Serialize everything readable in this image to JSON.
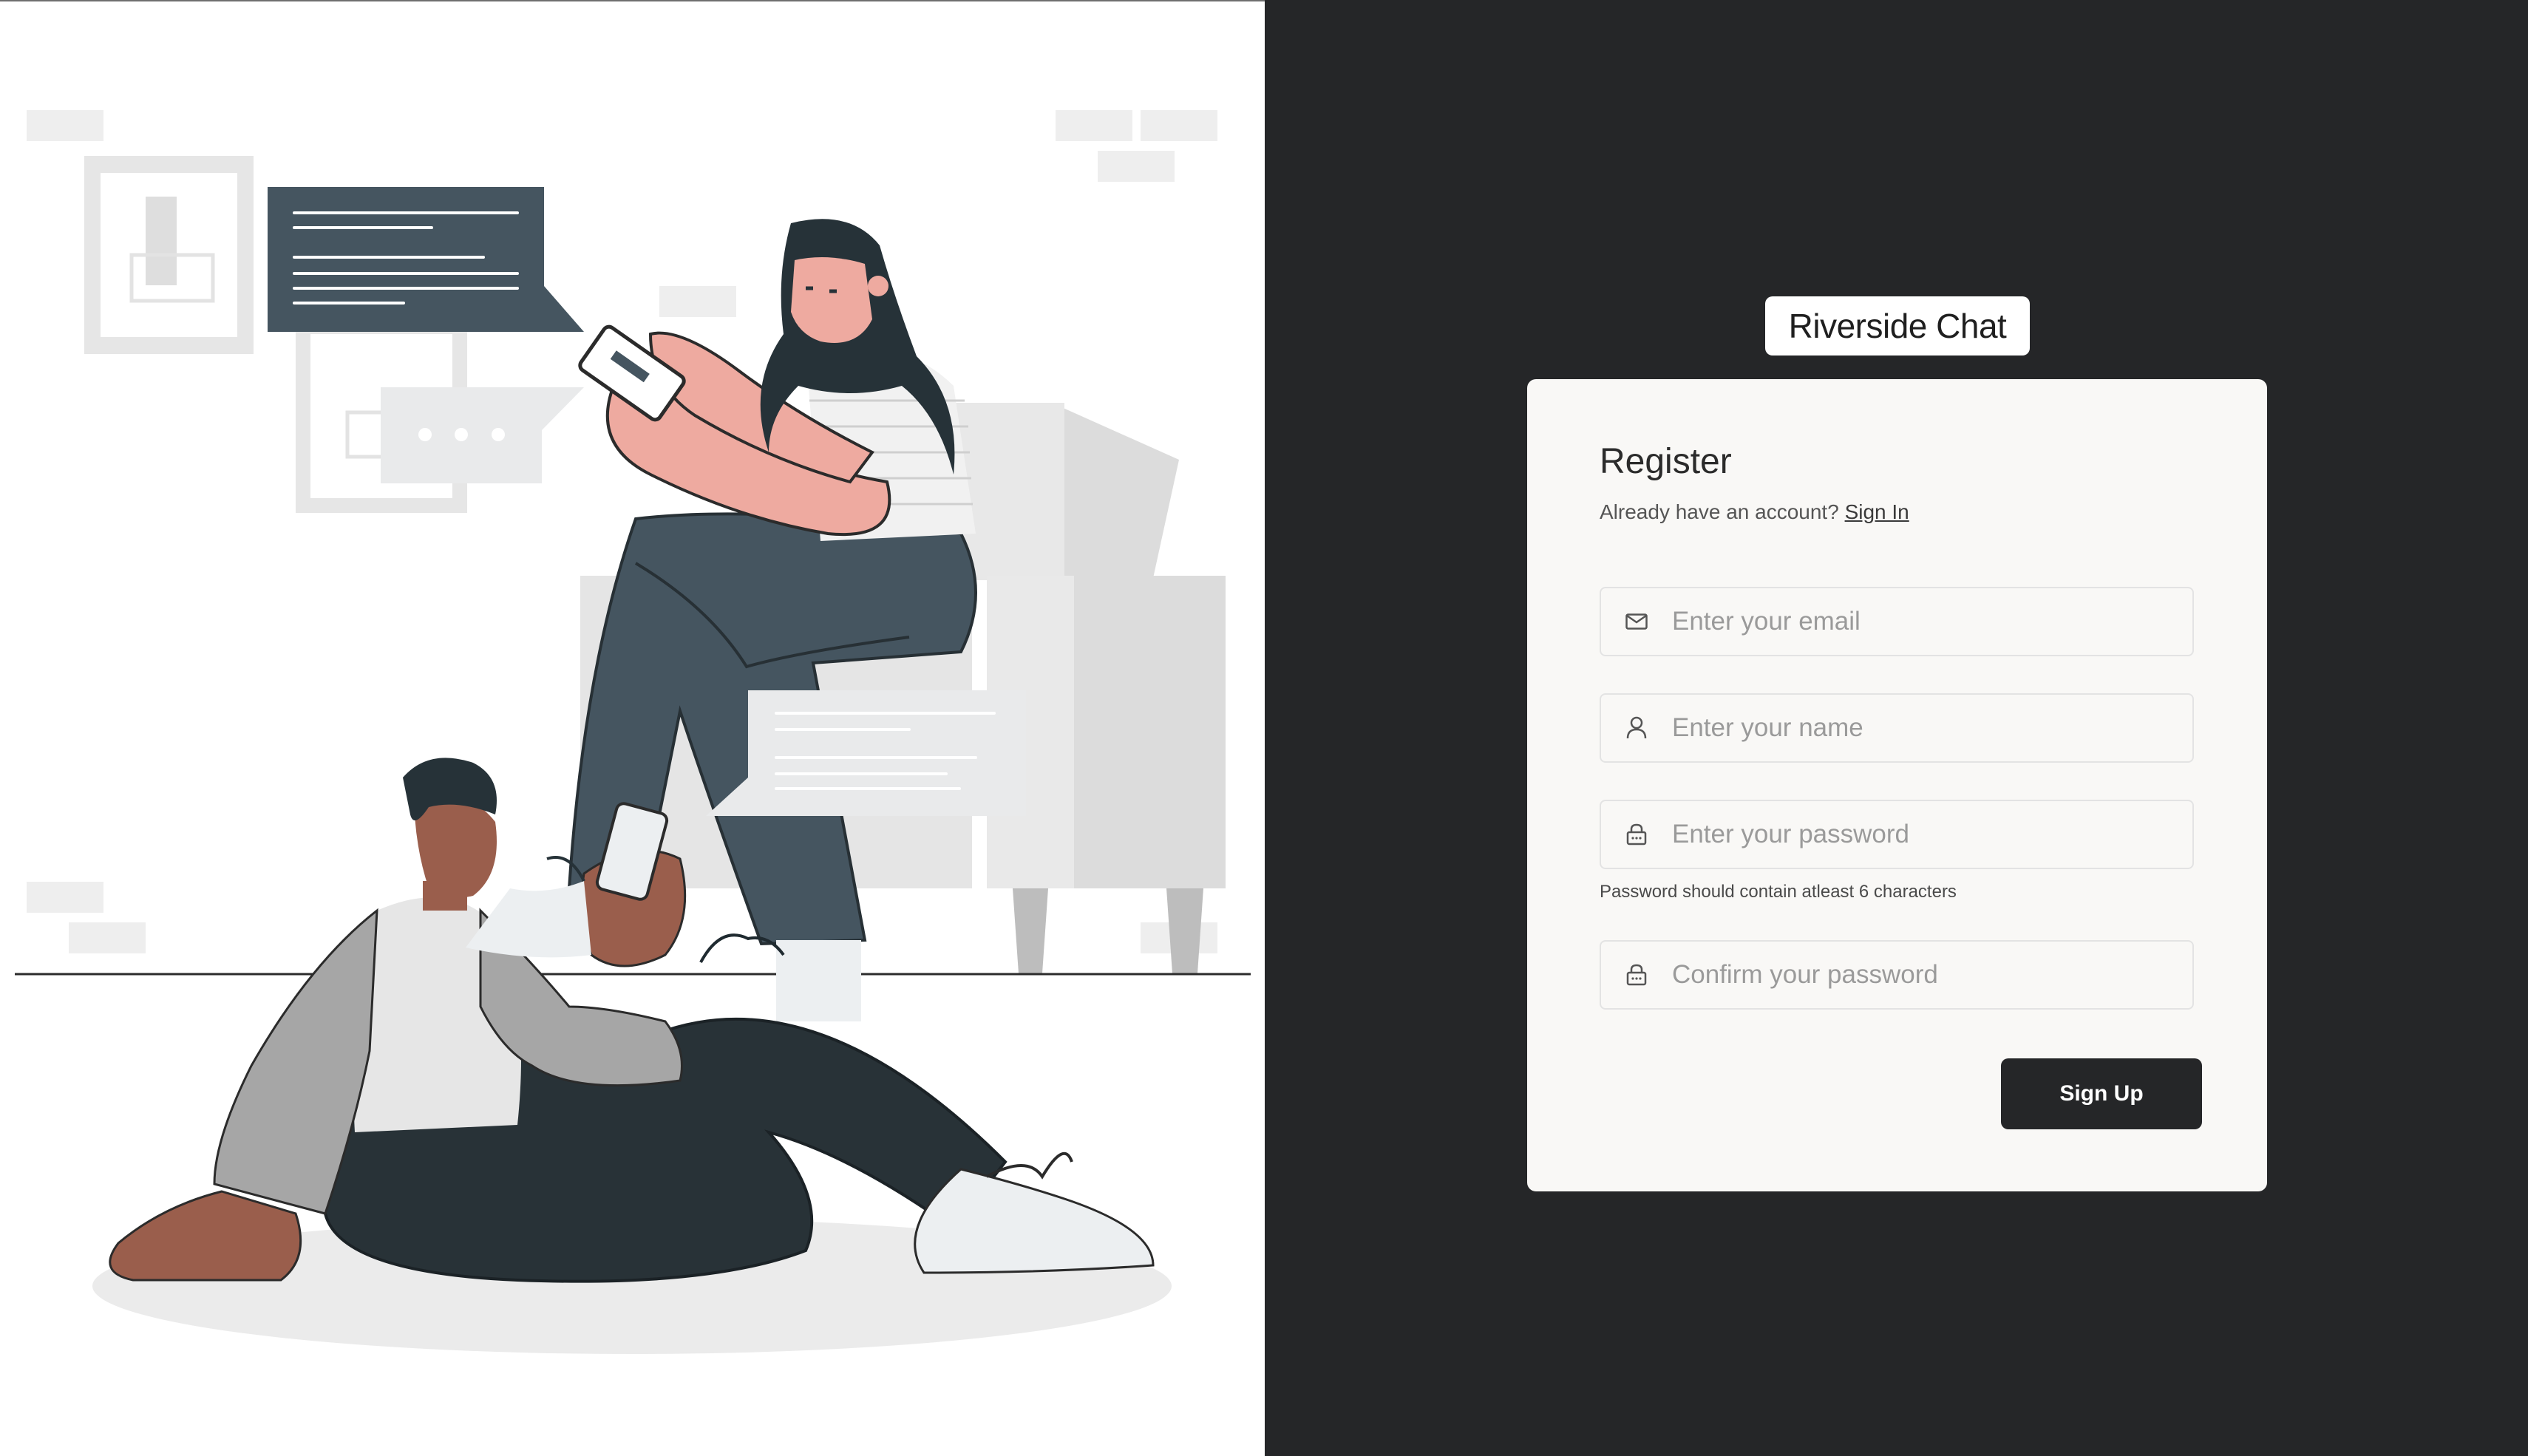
{
  "brand": {
    "title": "Riverside Chat"
  },
  "register": {
    "heading": "Register",
    "subtitle_prefix": "Already have an account?",
    "signin_link": "Sign In"
  },
  "fields": {
    "email": {
      "placeholder": "Enter your email",
      "value": "",
      "icon": "mail-icon"
    },
    "name": {
      "placeholder": "Enter your name",
      "value": "",
      "icon": "user-icon"
    },
    "password": {
      "placeholder": "Enter your password",
      "value": "",
      "icon": "lock-icon"
    },
    "password_hint": "Password should contain atleast 6 characters",
    "confirm": {
      "placeholder": "Confirm your password",
      "value": "",
      "icon": "lock-icon"
    }
  },
  "actions": {
    "signup_label": "Sign Up"
  },
  "colors": {
    "dark_panel": "#252628",
    "card_bg": "#f9f8f6",
    "accent_dark": "#455560",
    "skin_light": "#eeaaa0",
    "skin_dark": "#9a5e4c"
  }
}
